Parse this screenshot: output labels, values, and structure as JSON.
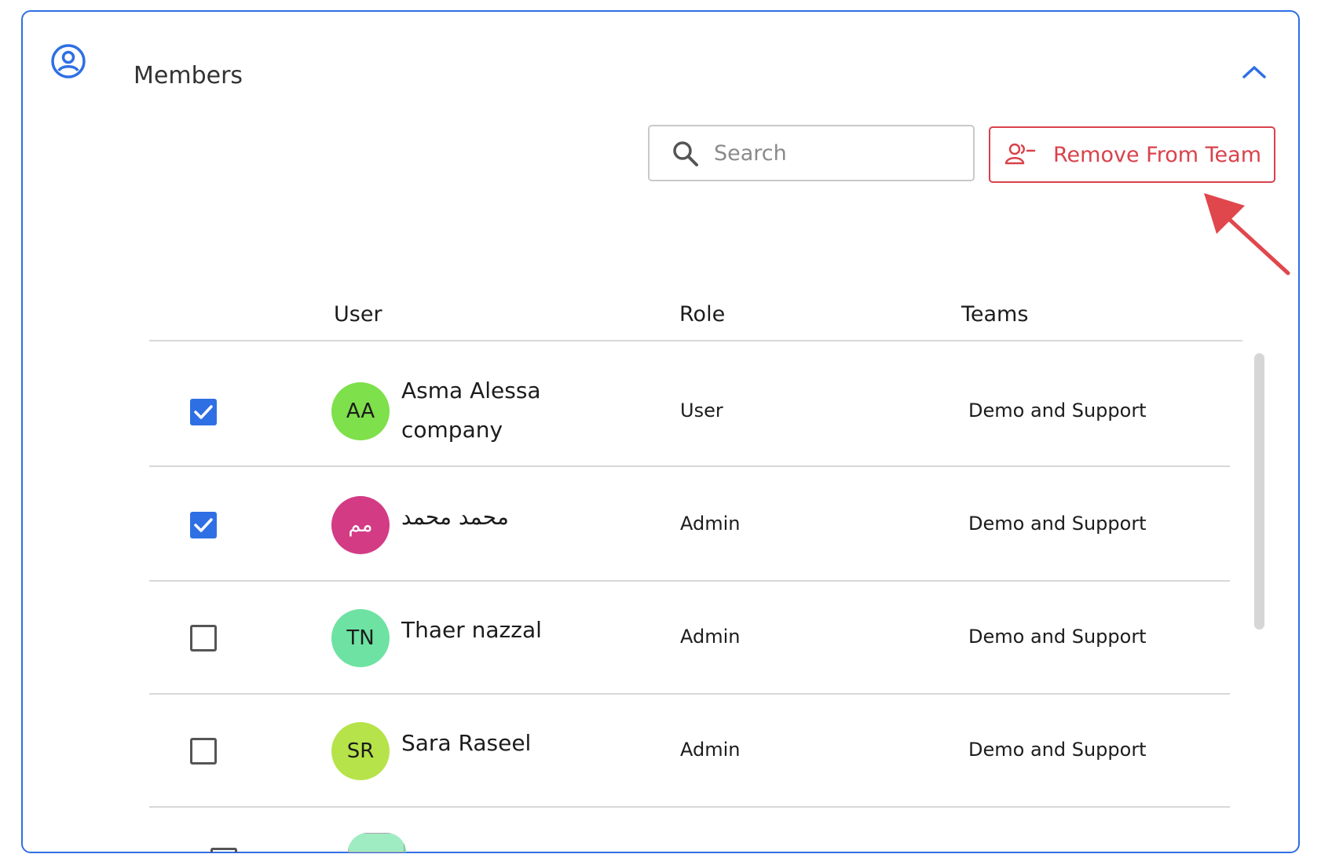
{
  "section": {
    "title": "Members",
    "icon": "user-circle-icon",
    "collapse_icon": "chevron-up-icon"
  },
  "search": {
    "placeholder": "Search",
    "icon": "search-icon"
  },
  "actions": {
    "remove_label": "Remove From Team",
    "remove_icon": "users-minus-icon"
  },
  "colors": {
    "accent": "#2f6fe4",
    "danger": "#d9424b"
  },
  "table": {
    "columns": [
      "User",
      "Role",
      "Teams"
    ],
    "rows": [
      {
        "checked": true,
        "initials": "AA",
        "avatar_color": "#7ee04a",
        "name": "Asma Alessa company",
        "role": "User",
        "team": "Demo and Support"
      },
      {
        "checked": true,
        "initials": "مم",
        "avatar_color": "#d33b85",
        "name": "محمد محمد",
        "role": "Admin",
        "team": "Demo and Support"
      },
      {
        "checked": false,
        "initials": "TN",
        "avatar_color": "#6ee2a2",
        "name": "Thaer nazzal",
        "role": "Admin",
        "team": "Demo and Support"
      },
      {
        "checked": false,
        "initials": "SR",
        "avatar_color": "#b6e34a",
        "name": "Sara Raseel",
        "role": "Admin",
        "team": "Demo and Support"
      }
    ]
  }
}
